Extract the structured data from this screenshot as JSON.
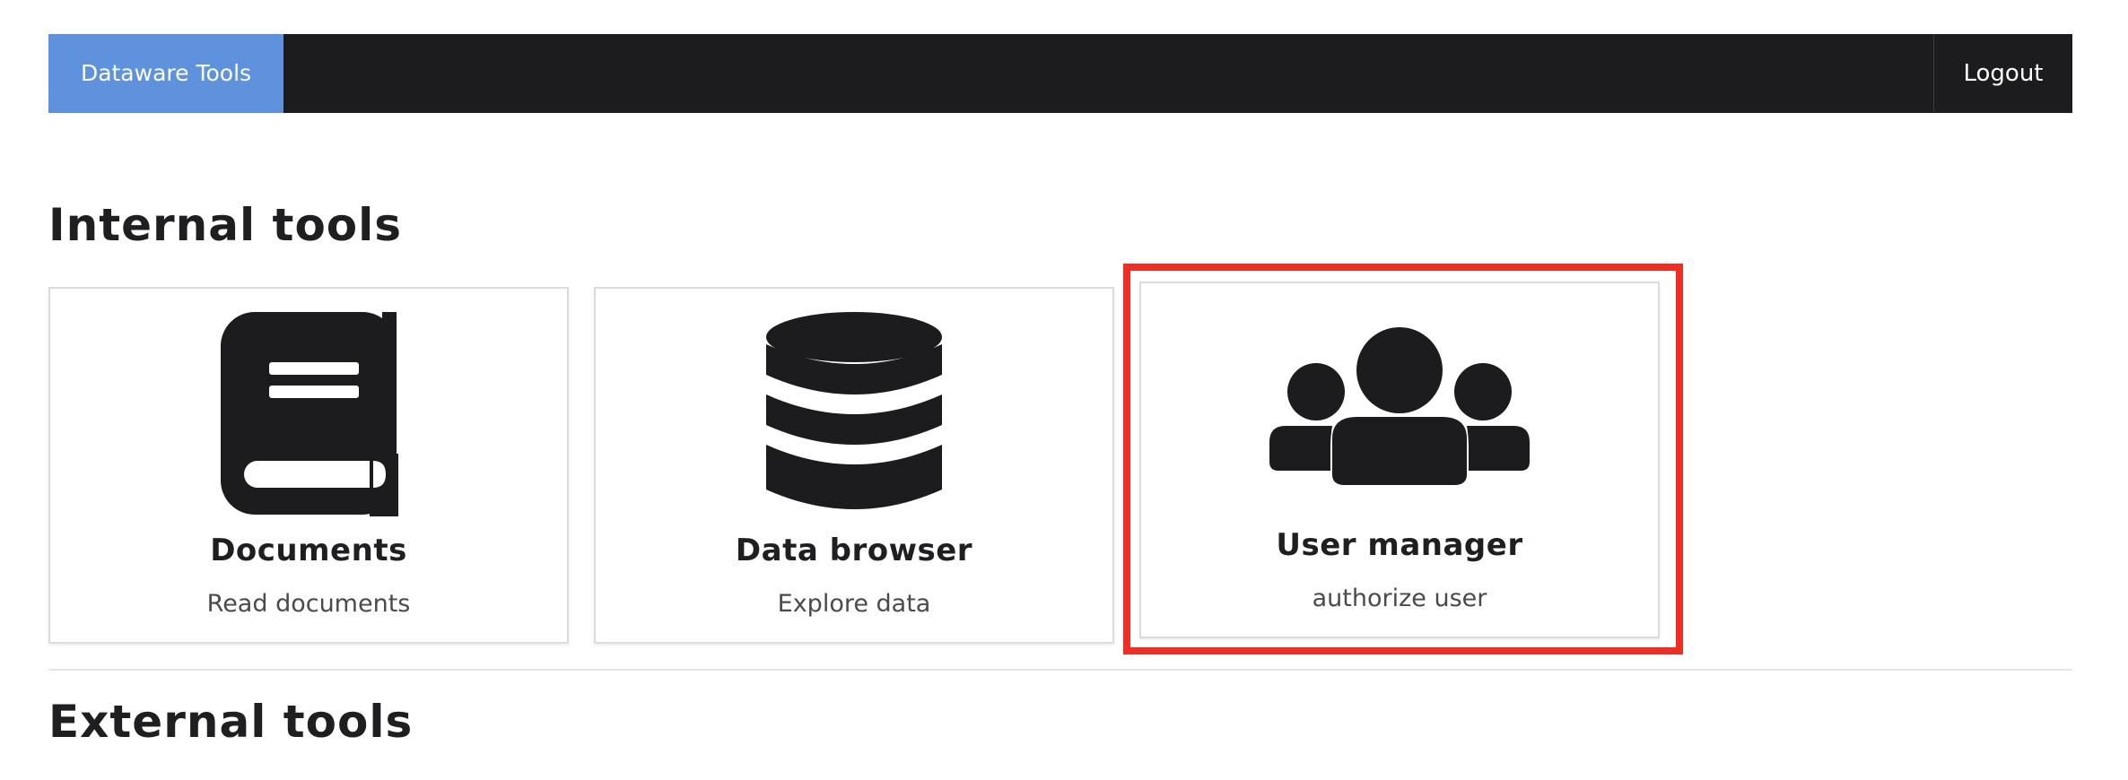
{
  "navbar": {
    "brand": "Dataware Tools",
    "logout": "Logout"
  },
  "sections": {
    "internal": "Internal tools",
    "external": "External tools"
  },
  "tools": [
    {
      "title": "Documents",
      "description": "Read documents",
      "icon": "book-icon"
    },
    {
      "title": "Data browser",
      "description": "Explore data",
      "icon": "database-icon"
    },
    {
      "title": "User manager",
      "description": "authorize user",
      "icon": "users-icon"
    }
  ],
  "colors": {
    "navbar": "#1c1c1e",
    "brand": "#5f92dd",
    "highlight": "#ee2e22",
    "icon": "#1c1c1e"
  }
}
